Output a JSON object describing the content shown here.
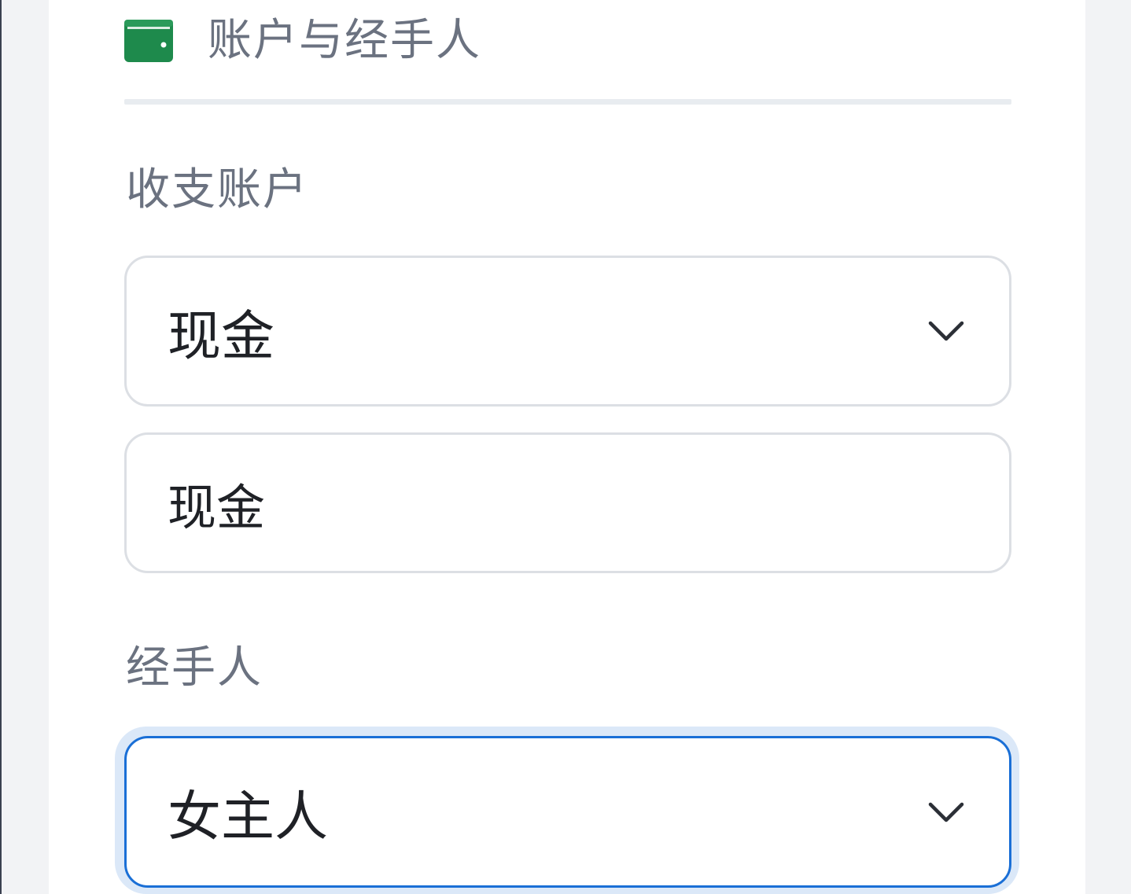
{
  "section": {
    "title": "账户与经手人",
    "icon": "wallet-icon",
    "icon_color": "#1e8a4c"
  },
  "account": {
    "label": "收支账户",
    "select_value": "现金",
    "input_value": "现金"
  },
  "handler": {
    "label": "经手人",
    "select_value": "女主人"
  },
  "colors": {
    "focus": "#1a6fd6",
    "label": "#6b7280",
    "border": "#dcdfe4"
  }
}
